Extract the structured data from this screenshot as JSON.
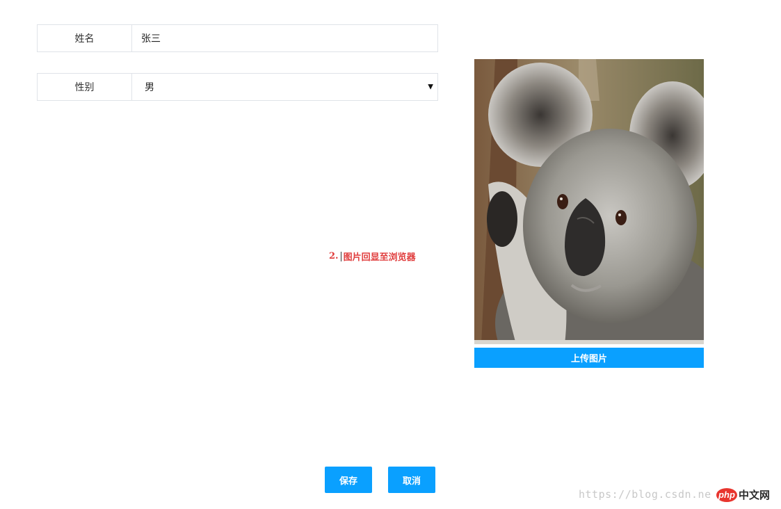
{
  "form": {
    "name_label": "姓名",
    "name_value": "张三",
    "gender_label": "性别",
    "gender_value": "男"
  },
  "annotation": {
    "prefix": "2.",
    "text": "图片回显至浏览器"
  },
  "upload": {
    "button_label": "上传图片",
    "image_icon": "koala-photo"
  },
  "actions": {
    "save_label": "保存",
    "cancel_label": "取消"
  },
  "watermark": {
    "url_text": "https://blog.csdn.ne",
    "logo_badge": "php",
    "logo_text": "中文网"
  },
  "colors": {
    "accent": "#0aa0ff",
    "annotation": "#e03c3c",
    "border": "#dfe3e8"
  }
}
